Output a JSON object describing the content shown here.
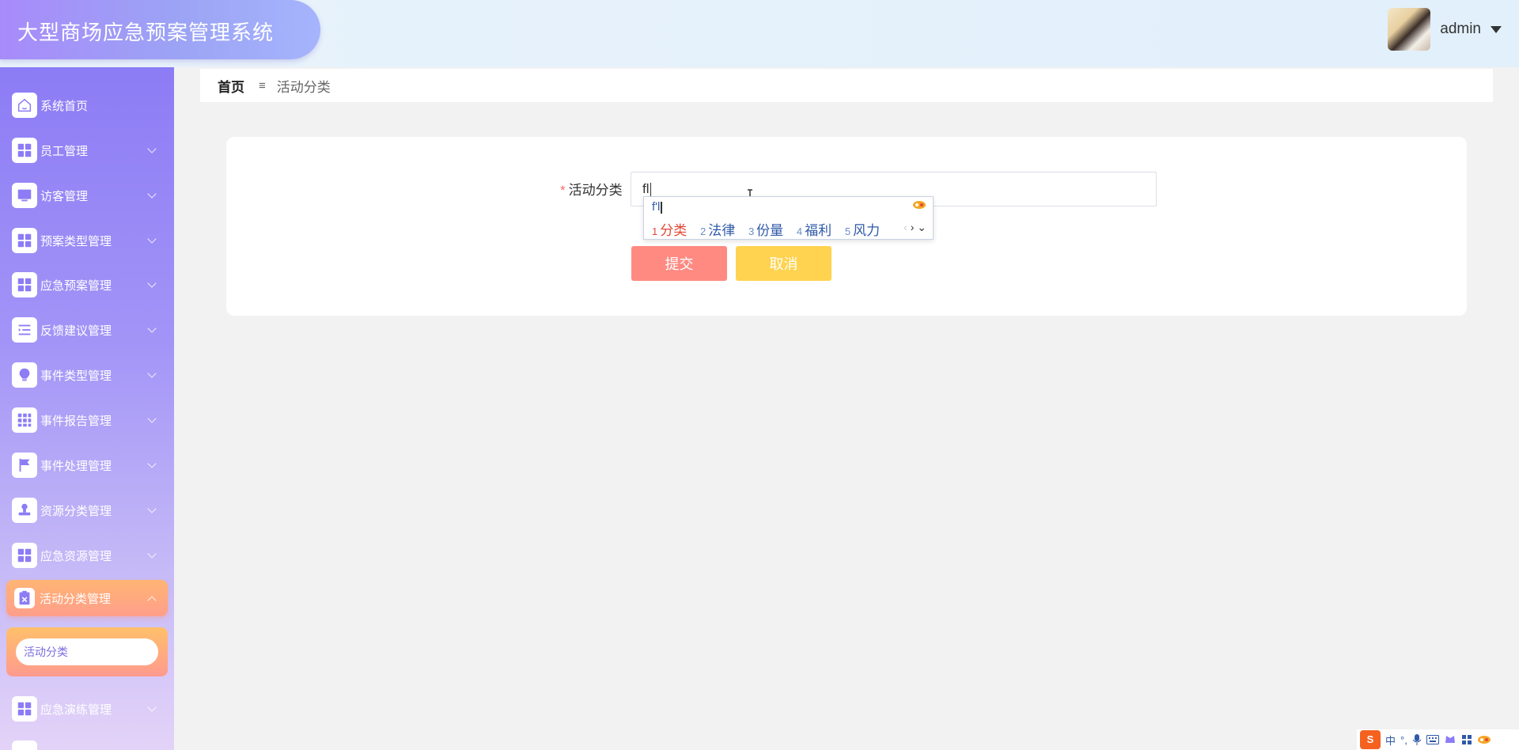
{
  "header": {
    "app_title": "大型商场应急预案管理系统",
    "username": "admin"
  },
  "sidebar": {
    "items": [
      {
        "label": "系统首页",
        "icon": "home-icon"
      },
      {
        "label": "员工管理",
        "icon": "grid-icon"
      },
      {
        "label": "访客管理",
        "icon": "monitor-icon"
      },
      {
        "label": "预案类型管理",
        "icon": "grid-icon"
      },
      {
        "label": "应急预案管理",
        "icon": "grid-icon"
      },
      {
        "label": "反馈建议管理",
        "icon": "list-icon"
      },
      {
        "label": "事件类型管理",
        "icon": "bulb-icon"
      },
      {
        "label": "事件报告管理",
        "icon": "grid9-icon"
      },
      {
        "label": "事件处理管理",
        "icon": "flag-icon"
      },
      {
        "label": "资源分类管理",
        "icon": "stamp-icon"
      },
      {
        "label": "应急资源管理",
        "icon": "grid-icon"
      },
      {
        "label": "活动分类管理",
        "icon": "clipboard-icon"
      },
      {
        "label": "应急演练管理",
        "icon": "grid-icon"
      }
    ],
    "submenu": {
      "label": "活动分类"
    }
  },
  "breadcrumb": {
    "home": "首页",
    "separator": "≡",
    "current": "活动分类"
  },
  "form": {
    "field_label": "活动分类",
    "required_mark": "*",
    "field_value": "fl",
    "submit_label": "提交",
    "cancel_label": "取消"
  },
  "ime": {
    "composition": "f'l",
    "candidates": [
      {
        "num": "1",
        "text": "分类"
      },
      {
        "num": "2",
        "text": "法律"
      },
      {
        "num": "3",
        "text": "份量"
      },
      {
        "num": "4",
        "text": "福利"
      },
      {
        "num": "5",
        "text": "风力"
      }
    ],
    "nav_prev": "‹",
    "nav_next": "›",
    "nav_expand": "⌄"
  },
  "tray": {
    "ime_logo": "S",
    "ime_mode": "中",
    "punct": "°,"
  },
  "colors": {
    "accent_purple": "#8c7cf5",
    "submit": "#ff8a82",
    "cancel": "#ffd34f",
    "required": "#f56c6c"
  }
}
